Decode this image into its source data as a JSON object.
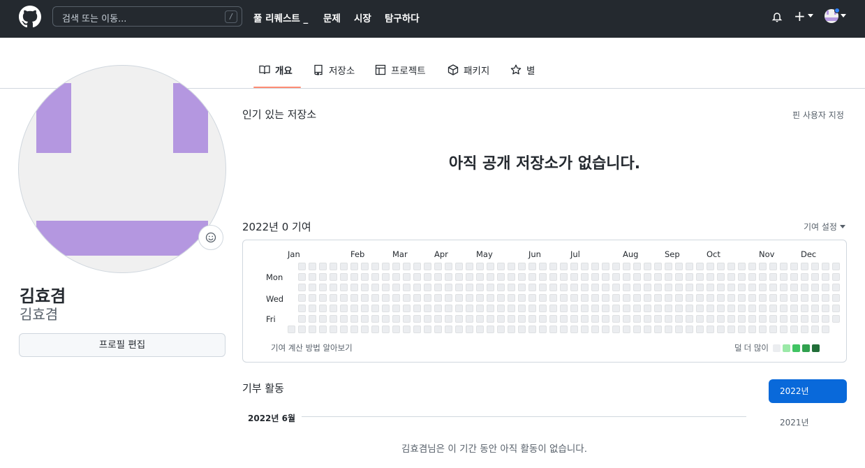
{
  "header": {
    "search_placeholder": "검색 또는 이동...",
    "slash_key": "/",
    "nav": [
      "풀 리퀘스트 _",
      "문제",
      "시장",
      "탐구하다"
    ],
    "plus_label": "+"
  },
  "tabs": [
    {
      "label": "개요",
      "icon": "book-icon",
      "active": true
    },
    {
      "label": "저장소",
      "icon": "repo-icon",
      "active": false
    },
    {
      "label": "프로젝트",
      "icon": "table-icon",
      "active": false
    },
    {
      "label": "패키지",
      "icon": "package-icon",
      "active": false
    },
    {
      "label": "별",
      "icon": "star-icon",
      "active": false
    }
  ],
  "profile": {
    "full_name": "김효겸",
    "login": "김효겸",
    "edit_button": "프로필 편집",
    "avatar_color": "#b497e0"
  },
  "popular": {
    "title": "인기 있는 저장소",
    "customize": "핀 사용자 지정",
    "empty": "아직 공개 저장소가 없습니다."
  },
  "contributions": {
    "title": "2022년 0 기여",
    "settings": "기여 설정",
    "months": [
      "Jan",
      "Feb",
      "Mar",
      "Apr",
      "May",
      "Jun",
      "Jul",
      "Aug",
      "Sep",
      "Oct",
      "Nov",
      "Dec"
    ],
    "days": [
      "Mon",
      "Wed",
      "Fri"
    ],
    "footer_link": "기여 계산 방법 알아보기",
    "legend_less": "덜",
    "legend_more": "더 많이",
    "legend_colors": [
      "#ebedf0",
      "#9be9a8",
      "#40c463",
      "#30a14e",
      "#216e39"
    ],
    "empty_color": "#ebedf0",
    "total": 0
  },
  "activity": {
    "title": "기부 활동",
    "month_heading": "2022년 6월",
    "empty_message": "김효겸님은 이 기간 동안 아직 활동이 없습니다.",
    "years": [
      {
        "label": "2022년",
        "selected": true
      },
      {
        "label": "2021년",
        "selected": false
      }
    ]
  }
}
